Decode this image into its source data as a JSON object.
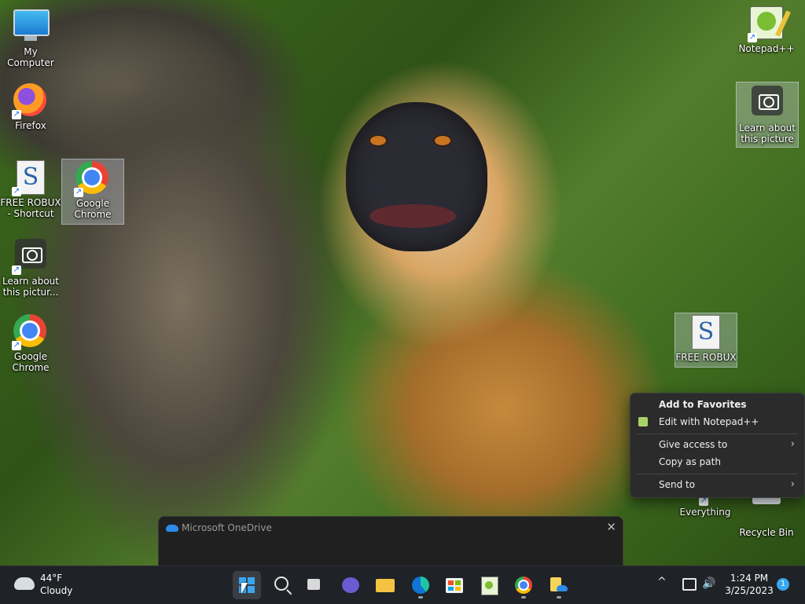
{
  "desktop": {
    "icons": {
      "my_computer": "My Computer",
      "firefox": "Firefox",
      "free_robux_shortcut": "FREE ROBUX - Shortcut",
      "google_chrome_1": "Google Chrome",
      "learn_about_1": "Learn about this pictur...",
      "google_chrome_2": "Google Chrome",
      "notepadpp": "Notepad++",
      "learn_about_2": "Learn about this picture",
      "free_robux": "FREE ROBUX",
      "everything": "Everything",
      "recycle_bin": "Recycle Bin"
    }
  },
  "context_menu": {
    "add_to_favorites": "Add to Favorites",
    "edit_with_notepadpp": "Edit with Notepad++",
    "give_access_to": "Give access to",
    "copy_as_path": "Copy as path",
    "send_to": "Send to",
    "arrow": "›"
  },
  "onedrive": {
    "title": "Microsoft OneDrive",
    "close": "✕"
  },
  "taskbar": {
    "weather": {
      "temp": "44°F",
      "condition": "Cloudy"
    },
    "tray": {
      "chevron": "^",
      "volume": "🔊"
    },
    "clock": {
      "time": "1:24 PM",
      "date": "3/25/2023"
    },
    "notifications": "1"
  }
}
